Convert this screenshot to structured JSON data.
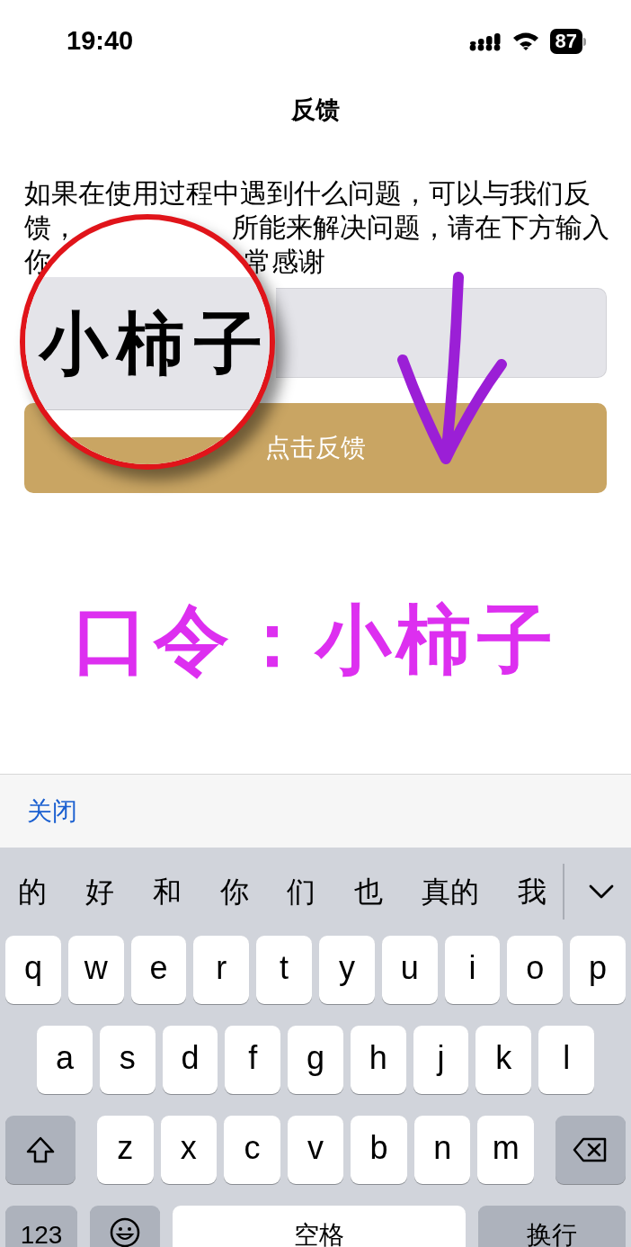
{
  "status_bar": {
    "time": "19:40",
    "battery": "87"
  },
  "nav": {
    "title": "反馈"
  },
  "intro_lines": [
    [
      "如果在使用过程中遇到什么问题，可以与我们反"
    ],
    [
      "馈，",
      "所能来解决问题，请在下方输入"
    ],
    [
      "你",
      "常感谢"
    ]
  ],
  "feedback_field": {
    "value": "小柿子"
  },
  "submit_button": "点击反馈",
  "annotation": {
    "text": "口令：小柿子"
  },
  "keyboard_toolbar": {
    "close": "关闭"
  },
  "candidates": [
    "的",
    "好",
    "和",
    "你",
    "们",
    "也",
    "真的",
    "我"
  ],
  "key_rows": [
    [
      {
        "kind": "letter",
        "label": "q"
      },
      {
        "kind": "letter",
        "label": "w"
      },
      {
        "kind": "letter",
        "label": "e"
      },
      {
        "kind": "letter",
        "label": "r"
      },
      {
        "kind": "letter",
        "label": "t"
      },
      {
        "kind": "letter",
        "label": "y"
      },
      {
        "kind": "letter",
        "label": "u"
      },
      {
        "kind": "letter",
        "label": "i"
      },
      {
        "kind": "letter",
        "label": "o"
      },
      {
        "kind": "letter",
        "label": "p"
      }
    ],
    [
      {
        "kind": "letter",
        "label": "a"
      },
      {
        "kind": "letter",
        "label": "s"
      },
      {
        "kind": "letter",
        "label": "d"
      },
      {
        "kind": "letter",
        "label": "f"
      },
      {
        "kind": "letter",
        "label": "g"
      },
      {
        "kind": "letter",
        "label": "h"
      },
      {
        "kind": "letter",
        "label": "j"
      },
      {
        "kind": "letter",
        "label": "k"
      },
      {
        "kind": "letter",
        "label": "l"
      }
    ],
    [
      {
        "kind": "shift"
      },
      {
        "kind": "letter",
        "label": "z"
      },
      {
        "kind": "letter",
        "label": "x"
      },
      {
        "kind": "letter",
        "label": "c"
      },
      {
        "kind": "letter",
        "label": "v"
      },
      {
        "kind": "letter",
        "label": "b"
      },
      {
        "kind": "letter",
        "label": "n"
      },
      {
        "kind": "letter",
        "label": "m"
      },
      {
        "kind": "delete"
      }
    ],
    [
      {
        "kind": "mode",
        "label": "123"
      },
      {
        "kind": "emoji"
      },
      {
        "kind": "space",
        "label": "空格"
      },
      {
        "kind": "return",
        "label": "换行"
      }
    ]
  ]
}
